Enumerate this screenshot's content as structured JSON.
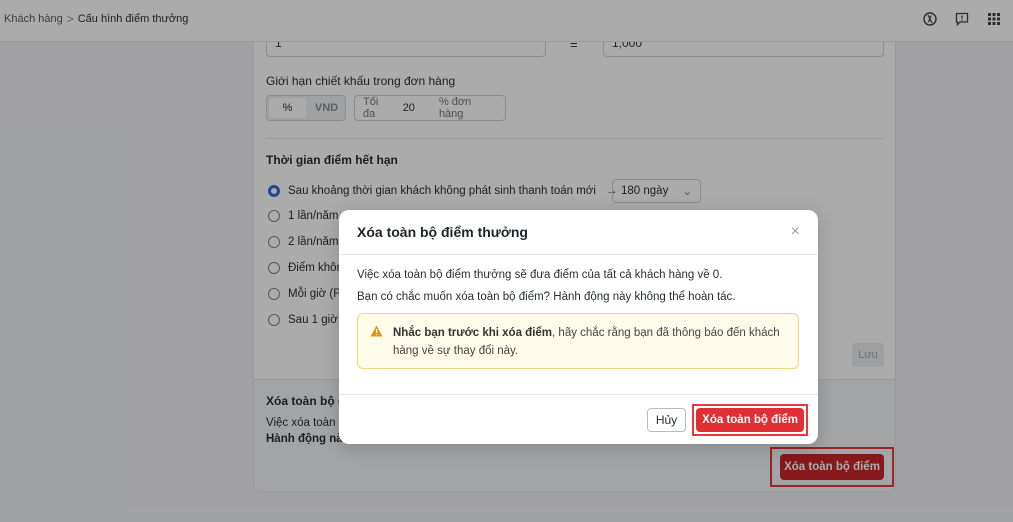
{
  "breadcrumb": {
    "parent": "Khách hàng",
    "separator": ">",
    "current": "Cấu hình điểm thưởng"
  },
  "form": {
    "points_value": "1",
    "equals": "=",
    "money_value": "1,000",
    "discount_limit_label": "Giới hạn chiết khấu trong đơn hàng",
    "unit_percent": "%",
    "unit_vnd": "VND",
    "max_prefix": "Tối đa",
    "max_value": "20",
    "max_suffix": "% đơn hàng",
    "expiry_title": "Thời gian điểm hết hạn",
    "expiry_options": [
      "Sau khoảng thời gian khách không phát sinh thanh toán mới",
      "1 lần/năm",
      "2 lần/năm",
      "Điểm khôn",
      "Mỗi giờ (F",
      "Sau 1 giờ l"
    ],
    "expiry_select": "180 ngày",
    "save_label": "Lưu"
  },
  "danger_zone": {
    "title": "Xóa toàn bộ đi",
    "line1": "Việc xóa toàn b",
    "line2": "Hành động nà",
    "button": "Xóa toàn bộ điểm"
  },
  "modal": {
    "title": "Xóa toàn bộ điểm thưởng",
    "close": "×",
    "p1": "Việc xóa toàn bộ điểm thưởng sẽ đưa điểm của tất cả khách hàng về 0.",
    "p2": "Bạn có chắc muốn xóa toàn bộ điểm? Hành động này không thể hoàn tác.",
    "warning_bold": "Nhắc bạn trước khi xóa điểm",
    "warning_rest": ", hãy chắc rằng bạn đã thông báo đến khách hàng về sự thay đổi này.",
    "cancel": "Hủy",
    "confirm": "Xóa toàn bộ điểm"
  },
  "colors": {
    "danger": "#e02f35",
    "highlight": "#e5393b",
    "radio_selected": "#2f6fd6",
    "warning_bg": "#fffbea"
  }
}
